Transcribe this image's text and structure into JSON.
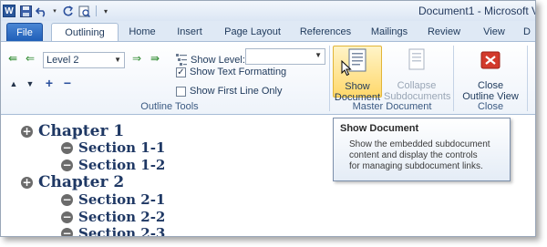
{
  "window": {
    "title": "Document1 - Microsoft V"
  },
  "tabs": {
    "file": "File",
    "outlining": "Outlining",
    "home": "Home",
    "insert": "Insert",
    "page_layout": "Page Layout",
    "references": "References",
    "mailings": "Mailings",
    "review": "Review",
    "view": "View",
    "partial": "D"
  },
  "outline_tools": {
    "level_value": "Level 2",
    "show_level_label": "Show Level:",
    "show_text_formatting": "Show Text Formatting",
    "show_text_formatting_checked": true,
    "show_first_line_only": "Show First Line Only",
    "show_first_line_only_checked": false,
    "group_label": "Outline Tools"
  },
  "master_document": {
    "show_document_line1": "Show",
    "show_document_line2": "Document",
    "collapse_line1": "Collapse",
    "collapse_line2": "Subdocuments",
    "group_label": "Master Document"
  },
  "close_group": {
    "close_line1": "Close",
    "close_line2": "Outline View",
    "group_label": "Close"
  },
  "tooltip": {
    "title": "Show Document",
    "body_line1": "Show the embedded subdocument",
    "body_line2": "content and display the controls",
    "body_line3": "for managing subdocument links."
  },
  "outline": [
    {
      "level": "chapter",
      "symbol": "+",
      "text": "Chapter 1"
    },
    {
      "level": "section",
      "symbol": "−",
      "text": "Section 1-1"
    },
    {
      "level": "section",
      "symbol": "−",
      "text": "Section 1-2"
    },
    {
      "level": "chapter",
      "symbol": "+",
      "text": "Chapter 2"
    },
    {
      "level": "section",
      "symbol": "−",
      "text": "Section 2-1"
    },
    {
      "level": "section",
      "symbol": "−",
      "text": "Section 2-2"
    },
    {
      "level": "section",
      "symbol": "−",
      "text": "Section 2-3"
    }
  ]
}
